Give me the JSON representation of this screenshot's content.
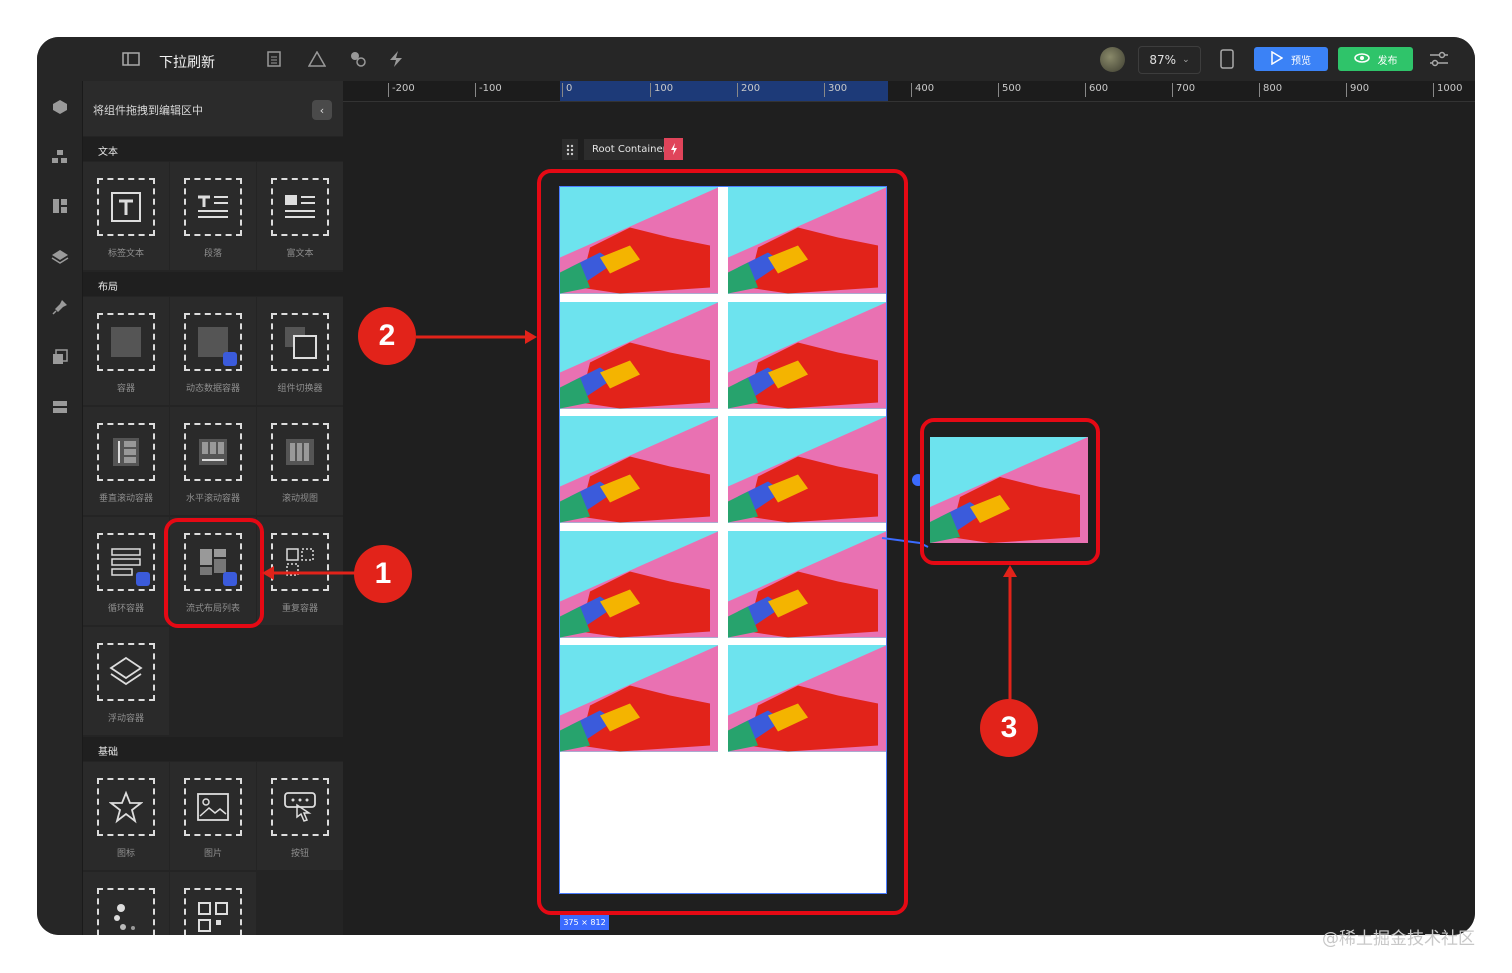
{
  "topbar": {
    "title": "下拉刷新",
    "zoom": "87%",
    "preview_label": "预览",
    "publish_label": "发布",
    "accent_blue": "#3b82f6",
    "accent_green": "#2fc46a"
  },
  "panel": {
    "header": "将组件拖拽到编辑区中",
    "sections": [
      {
        "title": "文本",
        "items": [
          "标签文本",
          "段落",
          "富文本"
        ]
      },
      {
        "title": "布局",
        "items": [
          "容器",
          "动态数据容器",
          "组件切换器",
          "垂直滚动容器",
          "水平滚动容器",
          "滚动视图",
          "循环容器",
          "流式布局列表",
          "重复容器",
          "浮动容器"
        ]
      },
      {
        "title": "基础",
        "items": [
          "图标",
          "图片",
          "按钮"
        ]
      }
    ]
  },
  "ruler": [
    "-200",
    "-100",
    "0",
    "100",
    "200",
    "300",
    "400",
    "500",
    "600",
    "700",
    "800",
    "900",
    "1000"
  ],
  "canvas": {
    "root_label": "Root Container",
    "size_tag": "375 × 812",
    "grid_rows": 5,
    "grid_cols": 2
  },
  "annotations": {
    "badge1": "1",
    "badge2": "2",
    "badge3": "3",
    "color": "#e50914"
  },
  "watermark": "@稀土掘金技术社区"
}
